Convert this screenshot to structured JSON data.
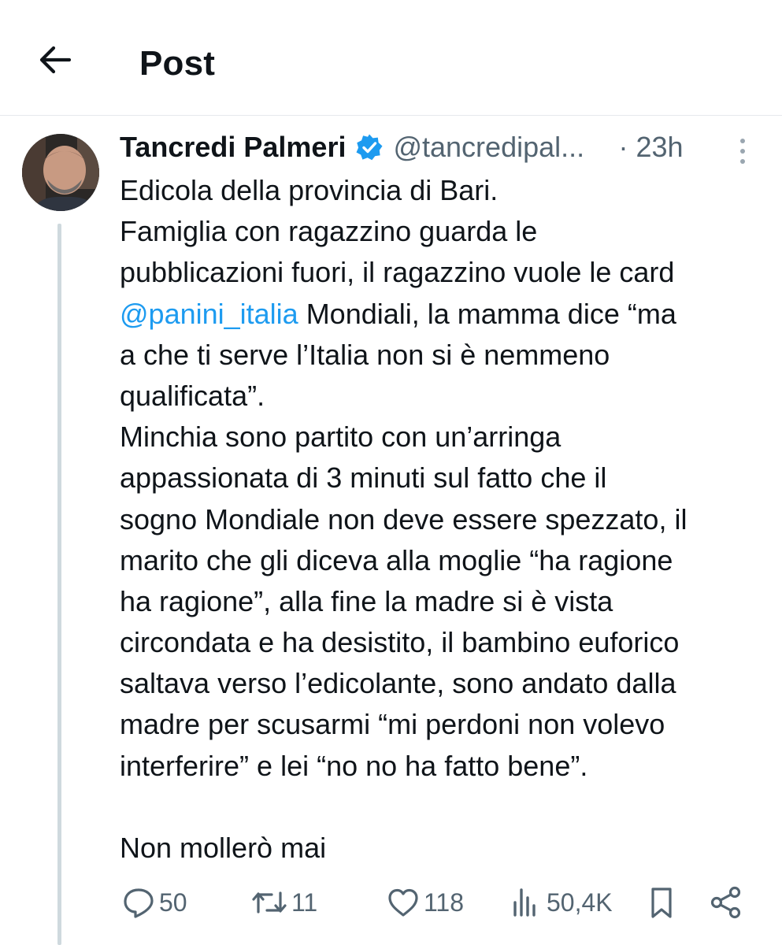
{
  "header": {
    "title": "Post"
  },
  "post": {
    "author_name": "Tancredi Palmeri",
    "handle": "@tancredipal...",
    "time": "· 23h",
    "text": {
      "l1": "Edicola della provincia di Bari.",
      "l2": "Famiglia con ragazzino guarda le",
      "l3": "pubblicazioni fuori, il ragazzino vuole le card",
      "mention": "@panini_italia",
      "l4_rest": " Mondiali, la mamma dice “ma",
      "l5": "a che ti serve l’Italia non si è nemmeno",
      "l6": "qualificata”.",
      "l7": "Minchia sono partito con un’arringa",
      "l8": "appassionata di 3 minuti sul fatto che il",
      "l9": "sogno Mondiale non deve essere spezzato, il",
      "l10": "marito che gli diceva alla moglie “ha ragione",
      "l11": "ha ragione”, alla fine la madre si è vista",
      "l12": "circondata e ha desistito, il bambino euforico",
      "l13": "saltava verso l’edicolante, sono andato dalla",
      "l14": "madre per scusarmi “mi perdoni non volevo",
      "l15": "interferire” e lei “no no ha fatto bene”.",
      "l16": "Non mollerò mai"
    },
    "stats": {
      "replies": "50",
      "reposts": "11",
      "likes": "118",
      "views": "50,4K"
    }
  },
  "colors": {
    "accent": "#1d9bf0",
    "text": "#0f1419",
    "secondary": "#536471",
    "thread_line": "#cfd9de"
  },
  "icons": [
    "back-arrow-icon",
    "verified-badge-icon",
    "more-vertical-icon",
    "reply-icon",
    "repost-icon",
    "like-icon",
    "views-icon",
    "bookmark-icon",
    "share-icon"
  ]
}
